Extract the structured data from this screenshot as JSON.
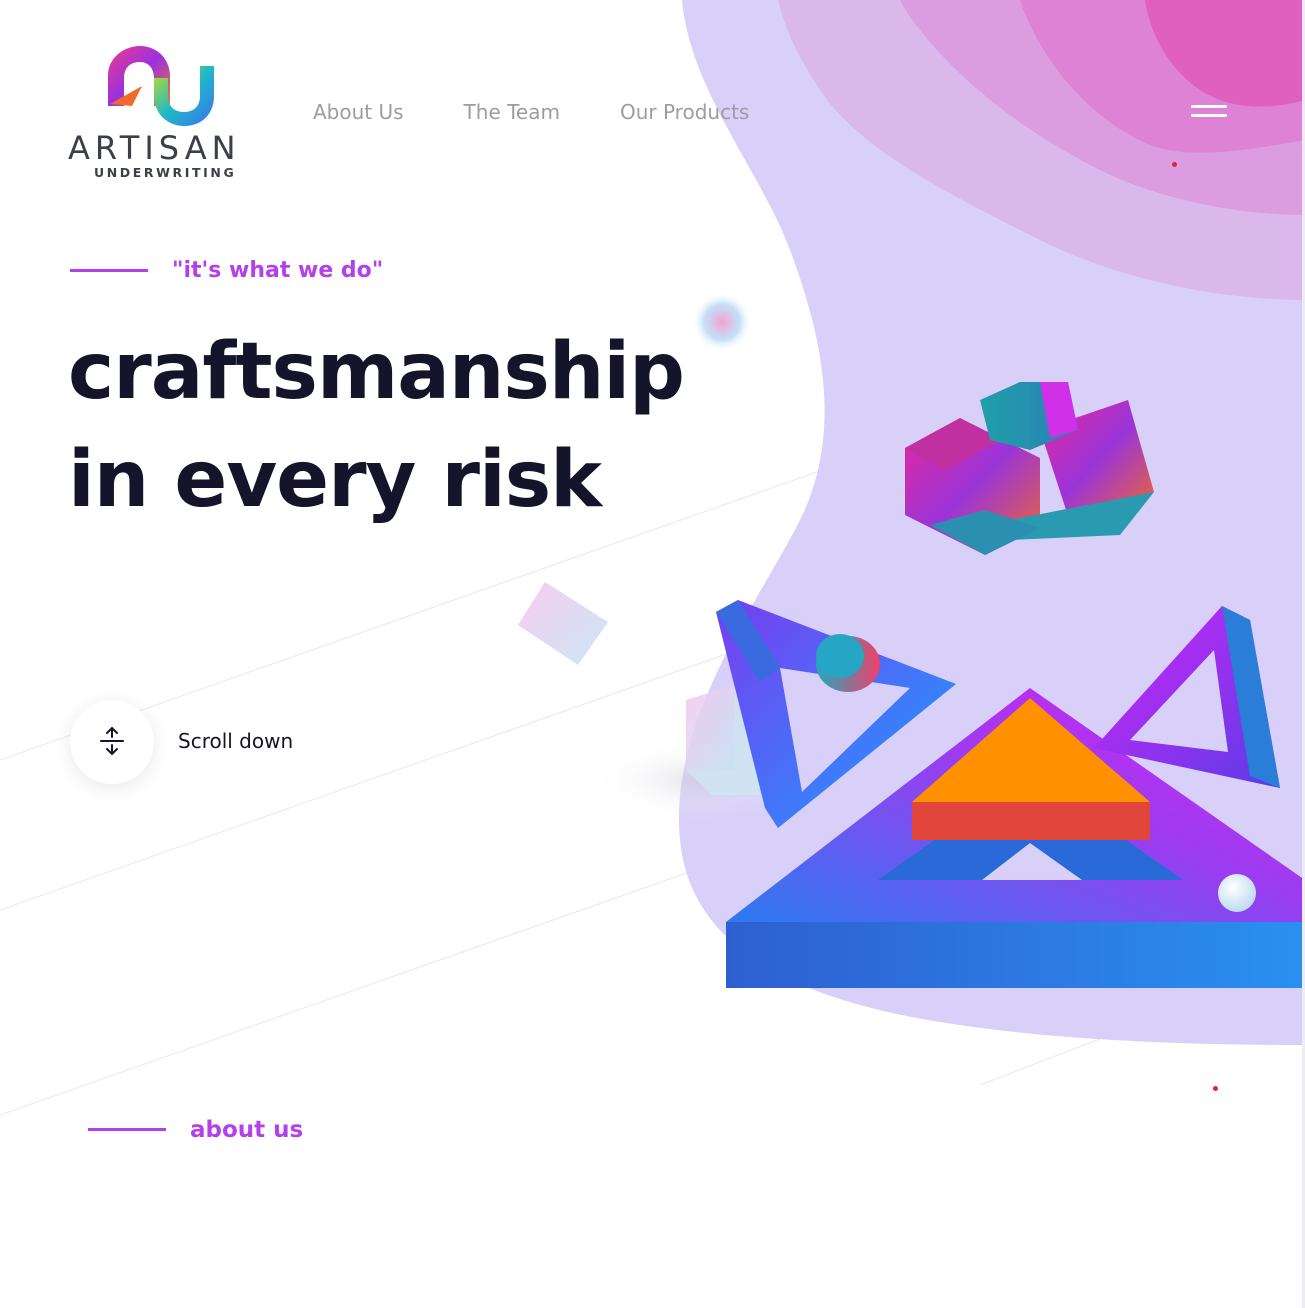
{
  "brand": {
    "name": "ARTISAN",
    "subtitle": "UNDERWRITING"
  },
  "nav": {
    "items": [
      {
        "label": "About Us"
      },
      {
        "label": "The Team"
      },
      {
        "label": "Our Products"
      }
    ],
    "menu_icon": "hamburger-menu-icon"
  },
  "hero": {
    "tagline": "\"it's what we do\"",
    "headline_line1": "craftsmanship",
    "headline_line2": "in every risk",
    "scroll_label": "Scroll down",
    "scroll_icon": "expand-vertical-icon"
  },
  "sections": {
    "about_label": "about us"
  },
  "colors": {
    "accent": "#b540ea",
    "heading": "#14142b",
    "nav_text": "#9b9ca6",
    "blob_lavender": "#d8d0f8",
    "blob_pink": "#e25cbc"
  }
}
